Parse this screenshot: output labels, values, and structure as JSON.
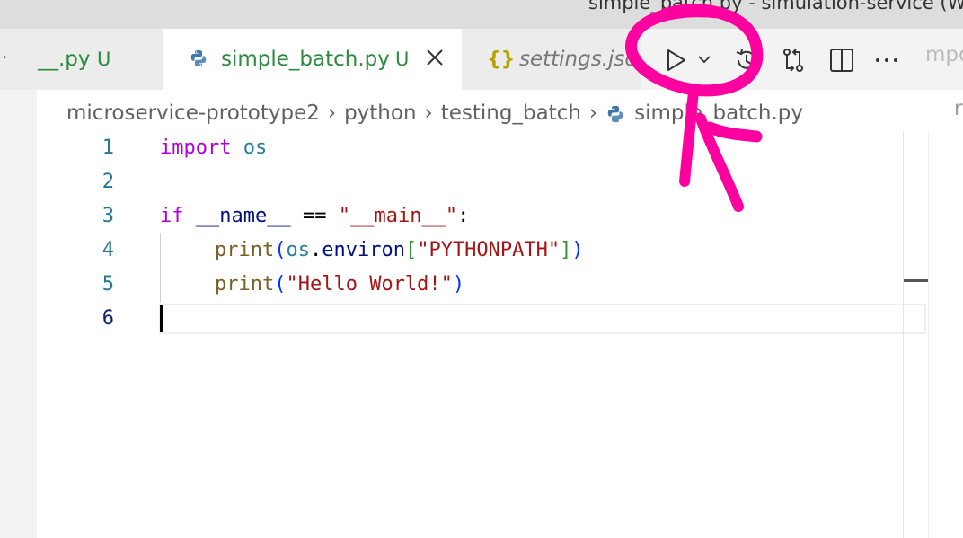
{
  "window": {
    "title": "simple_batch.py - simulation-service (W"
  },
  "tabs": [
    {
      "label": "__.py",
      "status": "U",
      "icon": "more-icon"
    },
    {
      "label": "simple_batch.py",
      "status": "U",
      "icon": "python-icon",
      "active": true
    },
    {
      "label": "settings.json",
      "icon": "json-braces-icon"
    }
  ],
  "tab_overflow_label": "mpo",
  "toolbar": {
    "run_icon": "play-icon",
    "run_dropdown_icon": "chevron-down-icon",
    "history_icon": "history-icon",
    "compare_icon": "git-compare-icon",
    "split_icon": "split-editor-icon",
    "more_icon": "ellipsis-icon"
  },
  "breadcrumb": [
    "microservice-prototype2",
    "python",
    "testing_batch",
    "simple_batch.py"
  ],
  "breadcrumb_right": "r",
  "editor": {
    "line_numbers": [
      "1",
      "2",
      "3",
      "4",
      "5",
      "6"
    ],
    "lines": {
      "l1_kw": "import",
      "l1_mod": "os",
      "l3_kw": "if",
      "l3_name": "__name__",
      "l3_op": "==",
      "l3_str": "\"__main__\"",
      "l3_colon": ":",
      "l4_func": "print",
      "l4_open": "(",
      "l4_mod": "os",
      "l4_dot": ".",
      "l4_attr": "environ",
      "l4_bopen": "[",
      "l4_str": "\"PYTHONPATH\"",
      "l4_bclose": "]",
      "l4_close": ")",
      "l5_func": "print",
      "l5_open": "(",
      "l5_str": "\"Hello World!\"",
      "l5_close": ")"
    }
  },
  "colors": {
    "annotation": "#ff00a0",
    "untracked": "#2b8a3e",
    "keyword": "#af00db",
    "string": "#a31515"
  }
}
